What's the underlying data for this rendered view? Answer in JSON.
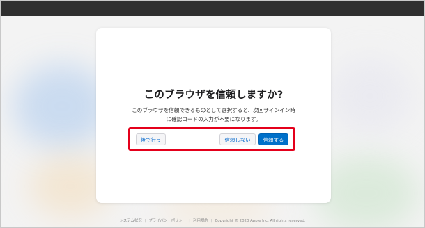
{
  "dialog": {
    "title": "このブラウザを信頼しますか?",
    "description_line1": "このブラウザを信頼できるものとして選択すると、次回サインイン時",
    "description_line2": "に確認コードの入力が不要になります。",
    "buttons": {
      "later": "後で行う",
      "dont_trust": "信頼しない",
      "trust": "信頼する"
    }
  },
  "footer": {
    "system_status": "システム状況",
    "privacy_policy": "プライバシーポリシー",
    "terms": "利用規約",
    "copyright": "Copyright © 2020 Apple Inc. All rights reserved."
  },
  "colors": {
    "primary_button": "#0070c9",
    "link": "#0066cc",
    "highlight_border": "#e4001b",
    "top_bar": "#2f2f2f"
  }
}
